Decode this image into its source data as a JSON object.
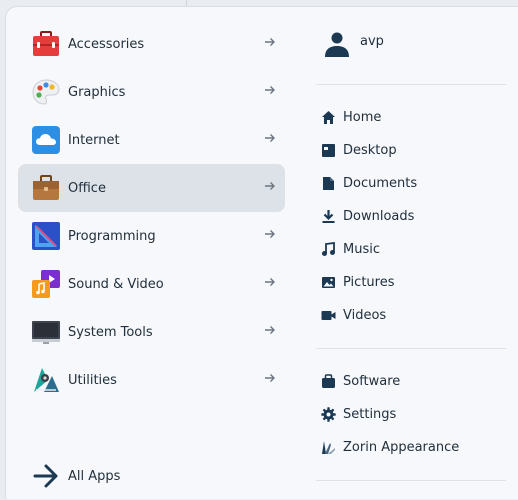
{
  "categories": [
    {
      "label": "Accessories"
    },
    {
      "label": "Graphics"
    },
    {
      "label": "Internet"
    },
    {
      "label": "Office"
    },
    {
      "label": "Programming"
    },
    {
      "label": "Sound & Video"
    },
    {
      "label": "System Tools"
    },
    {
      "label": "Utilities"
    }
  ],
  "all_apps": {
    "label": "All Apps"
  },
  "user": {
    "name": "avp"
  },
  "places": [
    {
      "label": "Home",
      "icon": "home-icon"
    },
    {
      "label": "Desktop",
      "icon": "desktop-icon"
    },
    {
      "label": "Documents",
      "icon": "document-icon"
    },
    {
      "label": "Downloads",
      "icon": "download-icon"
    },
    {
      "label": "Music",
      "icon": "music-icon"
    },
    {
      "label": "Pictures",
      "icon": "picture-icon"
    },
    {
      "label": "Videos",
      "icon": "video-icon"
    }
  ],
  "system": [
    {
      "label": "Software",
      "icon": "software-icon"
    },
    {
      "label": "Settings",
      "icon": "gear-icon"
    },
    {
      "label": "Zorin Appearance",
      "icon": "appearance-icon"
    }
  ],
  "colors": {
    "accent_dark": "#1c3954",
    "active_bg": "#dde2e9",
    "panel_bg": "#f6f8fb"
  }
}
